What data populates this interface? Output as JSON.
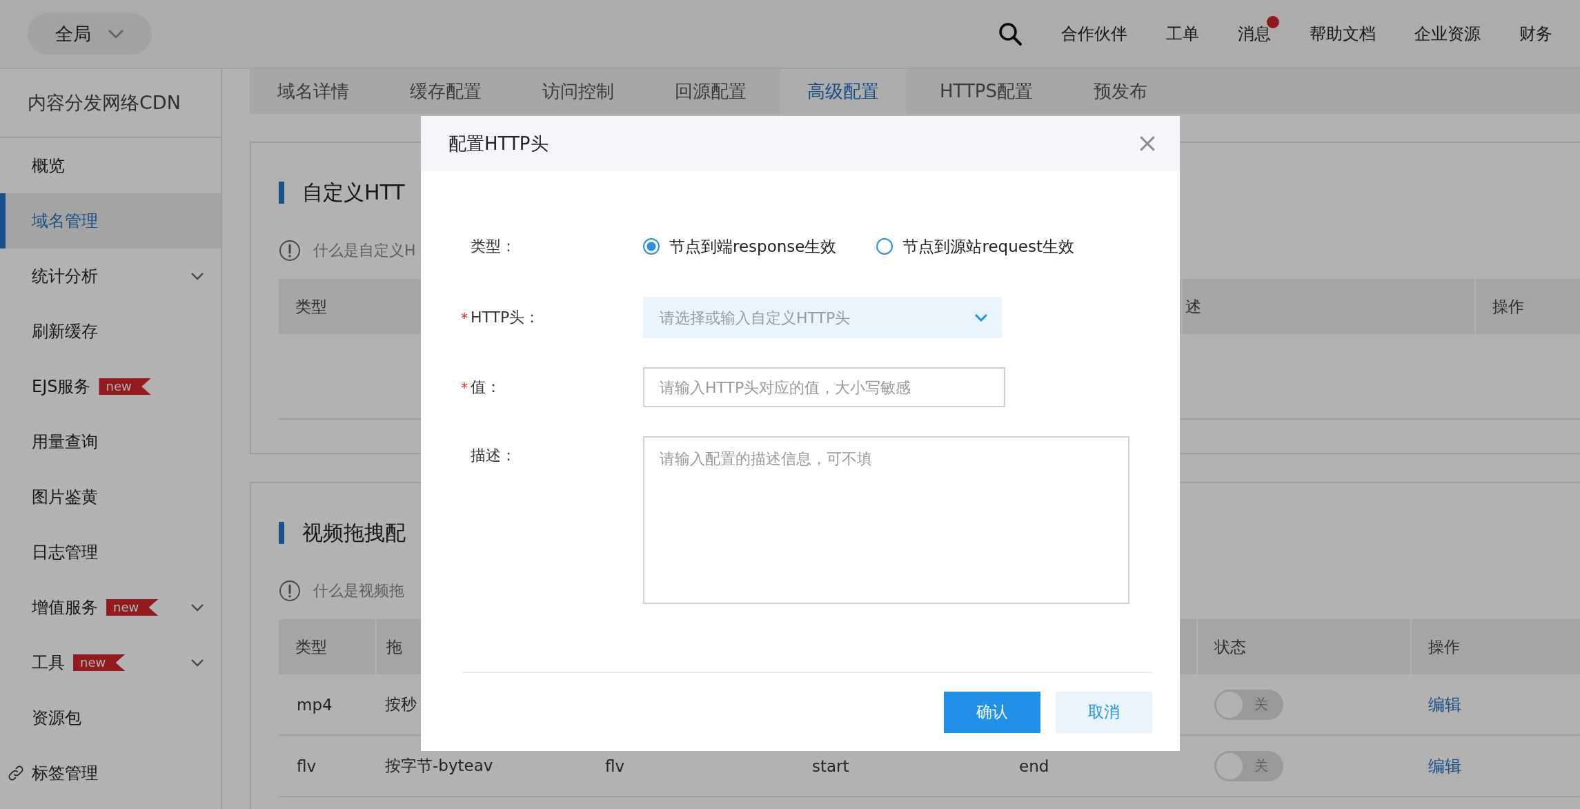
{
  "top_bar": {
    "scope": "全局",
    "nav": [
      {
        "label": "合作伙伴",
        "badge": false
      },
      {
        "label": "工单",
        "badge": false
      },
      {
        "label": "消息",
        "badge": true
      },
      {
        "label": "帮助文档",
        "badge": false
      },
      {
        "label": "企业资源",
        "badge": false
      },
      {
        "label": "财务",
        "badge": false
      }
    ]
  },
  "sidebar": {
    "title": "内容分发网络CDN",
    "items": [
      {
        "label": "概览",
        "selected": false,
        "expandable": false,
        "kind": "menu"
      },
      {
        "label": "域名管理",
        "selected": true,
        "expandable": false,
        "kind": "menu"
      },
      {
        "label": "统计分析",
        "selected": false,
        "expandable": true,
        "kind": "menu"
      },
      {
        "label": "刷新缓存",
        "selected": false,
        "expandable": false,
        "kind": "menu"
      },
      {
        "label": "EJS服务",
        "selected": false,
        "expandable": false,
        "kind": "menu",
        "tag": "new"
      },
      {
        "label": "用量查询",
        "selected": false,
        "expandable": false,
        "kind": "menu"
      },
      {
        "label": "图片鉴黄",
        "selected": false,
        "expandable": false,
        "kind": "menu"
      },
      {
        "label": "日志管理",
        "selected": false,
        "expandable": false,
        "kind": "menu"
      },
      {
        "label": "增值服务",
        "selected": false,
        "expandable": true,
        "kind": "menu",
        "tag": "new"
      },
      {
        "label": "工具",
        "selected": false,
        "expandable": true,
        "kind": "menu",
        "tag": "new"
      },
      {
        "label": "资源包",
        "selected": false,
        "expandable": false,
        "kind": "menu"
      },
      {
        "label": "标签管理",
        "selected": false,
        "expandable": false,
        "kind": "link"
      }
    ]
  },
  "tabs": [
    {
      "label": "域名详情",
      "selected": false
    },
    {
      "label": "缓存配置",
      "selected": false
    },
    {
      "label": "访问控制",
      "selected": false
    },
    {
      "label": "回源配置",
      "selected": false
    },
    {
      "label": "高级配置",
      "selected": true
    },
    {
      "label": "HTTPS配置",
      "selected": false
    },
    {
      "label": "预发布",
      "selected": false
    }
  ],
  "sections": [
    {
      "title": "自定义HTT",
      "info": "什么是自定义H",
      "columns": [
        "类型",
        "述",
        "操作"
      ]
    },
    {
      "title": "视频拖拽配",
      "info": "什么是视频拖",
      "columns": [
        "类型",
        "拖",
        "状态",
        "操作"
      ],
      "rows": [
        {
          "type": "mp4",
          "mode": "按秒",
          "toggle": {
            "on": false,
            "label": "关"
          },
          "action": "编辑"
        },
        {
          "type": "flv",
          "mode": "按字节-byteav",
          "column_3": "flv",
          "column_4": "start",
          "column_5": "end",
          "toggle": {
            "on": false,
            "label": "关"
          },
          "action": "编辑"
        }
      ]
    }
  ],
  "dialog": {
    "title": "配置HTTP头",
    "fields": [
      {
        "kind": "radio",
        "label": "类型：",
        "required": false,
        "options": [
          {
            "label": "节点到端response生效",
            "selected": true
          },
          {
            "label": "节点到源站request生效",
            "selected": false
          }
        ]
      },
      {
        "kind": "select",
        "label": "HTTP头：",
        "required": true,
        "placeholder": "请选择或输入自定义HTTP头"
      },
      {
        "kind": "input",
        "label": "值：",
        "required": true,
        "placeholder": "请输入HTTP头对应的值，大小写敏感"
      },
      {
        "kind": "textarea",
        "label": "描述：",
        "required": false,
        "placeholder": "请输入配置的描述信息，可不填"
      }
    ],
    "required_mark": "*",
    "buttons": [
      {
        "label": "确认",
        "primary": true
      },
      {
        "label": "取消",
        "primary": false
      }
    ]
  }
}
